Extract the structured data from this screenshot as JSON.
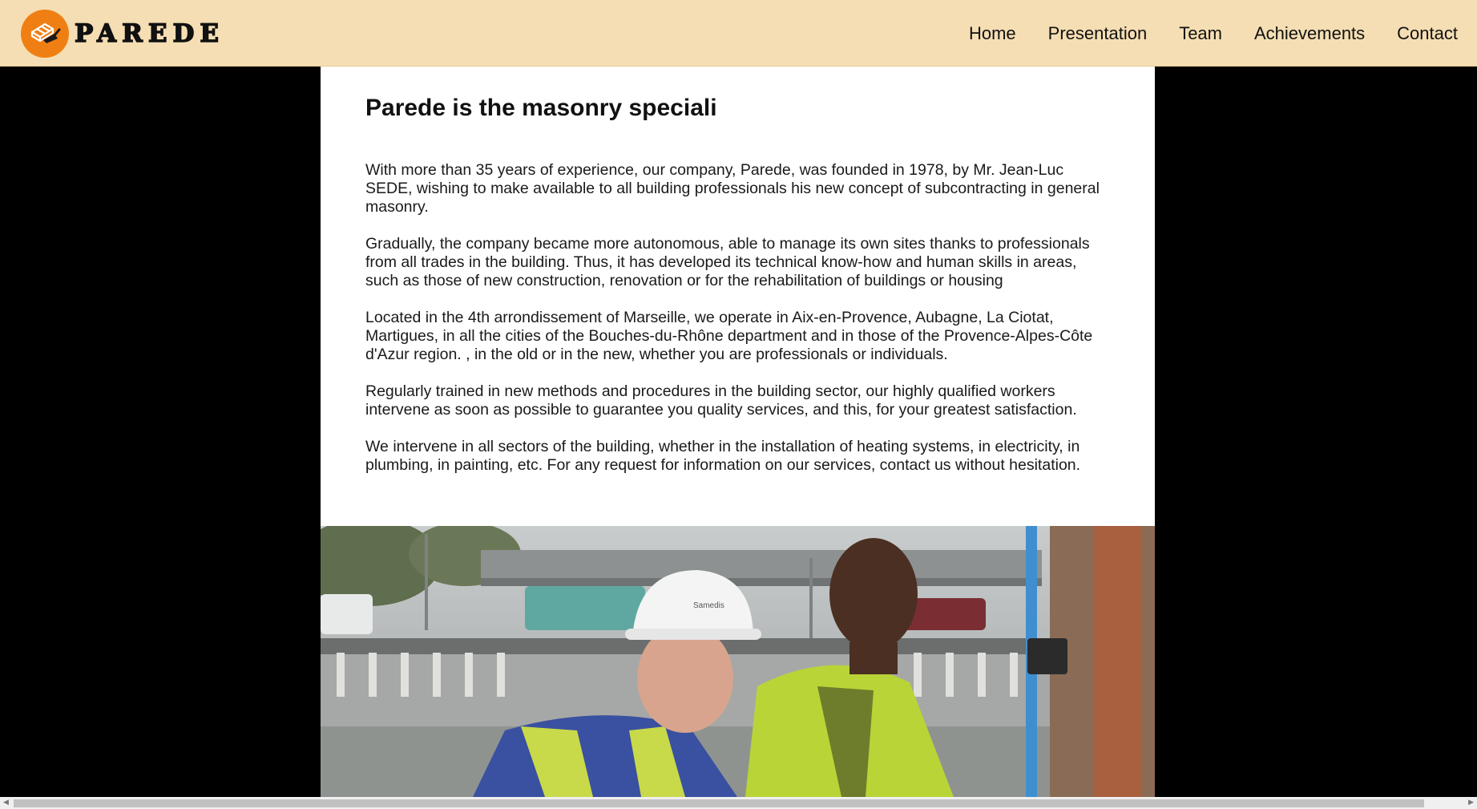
{
  "brand": {
    "name": "PAREDE",
    "logo_icon": "brick-trowel-icon",
    "accent_color": "#f07f13",
    "nav_bg_color": "#f5deb3"
  },
  "nav": {
    "items": [
      {
        "label": "Home"
      },
      {
        "label": "Presentation"
      },
      {
        "label": "Team"
      },
      {
        "label": "Achievements"
      },
      {
        "label": "Contact"
      }
    ]
  },
  "main": {
    "title": "Parede is the masonry speciali",
    "paragraphs": [
      "With more than 35 years of experience, our company, Parede, was founded in 1978, by Mr. Jean-Luc SEDE, wishing to make available to all building professionals his new concept of subcontracting in general masonry.",
      "Gradually, the company became more autonomous, able to manage its own sites thanks to professionals from all trades in the building. Thus, it has developed its technical know-how and human skills in areas, such as those of new construction, renovation or for the rehabilitation of buildings or housing",
      "Located in the 4th arrondissement of Marseille, we operate in Aix-en-Provence, Aubagne, La Ciotat, Martigues, in all the cities of the Bouches-du-Rhône department and in those of the Provence-Alpes-Côte d'Azur region. , in the old or in the new, whether you are professionals or individuals.",
      "Regularly trained in new methods and procedures in the building sector, our highly qualified workers intervene as soon as possible to guarantee you quality services, and this, for your greatest satisfaction.",
      "We intervene in all sectors of the building, whether in the installation of heating systems, in electricity, in plumbing, in painting, etc. For any request for information on our services, contact us without hesitation."
    ]
  },
  "photo": {
    "subject": "two-construction-workers-photo",
    "helmet_brand": "Samedis"
  },
  "scrollbar": {
    "left_arrow_icon": "chevron-left-icon",
    "right_arrow_icon": "chevron-right-icon"
  }
}
